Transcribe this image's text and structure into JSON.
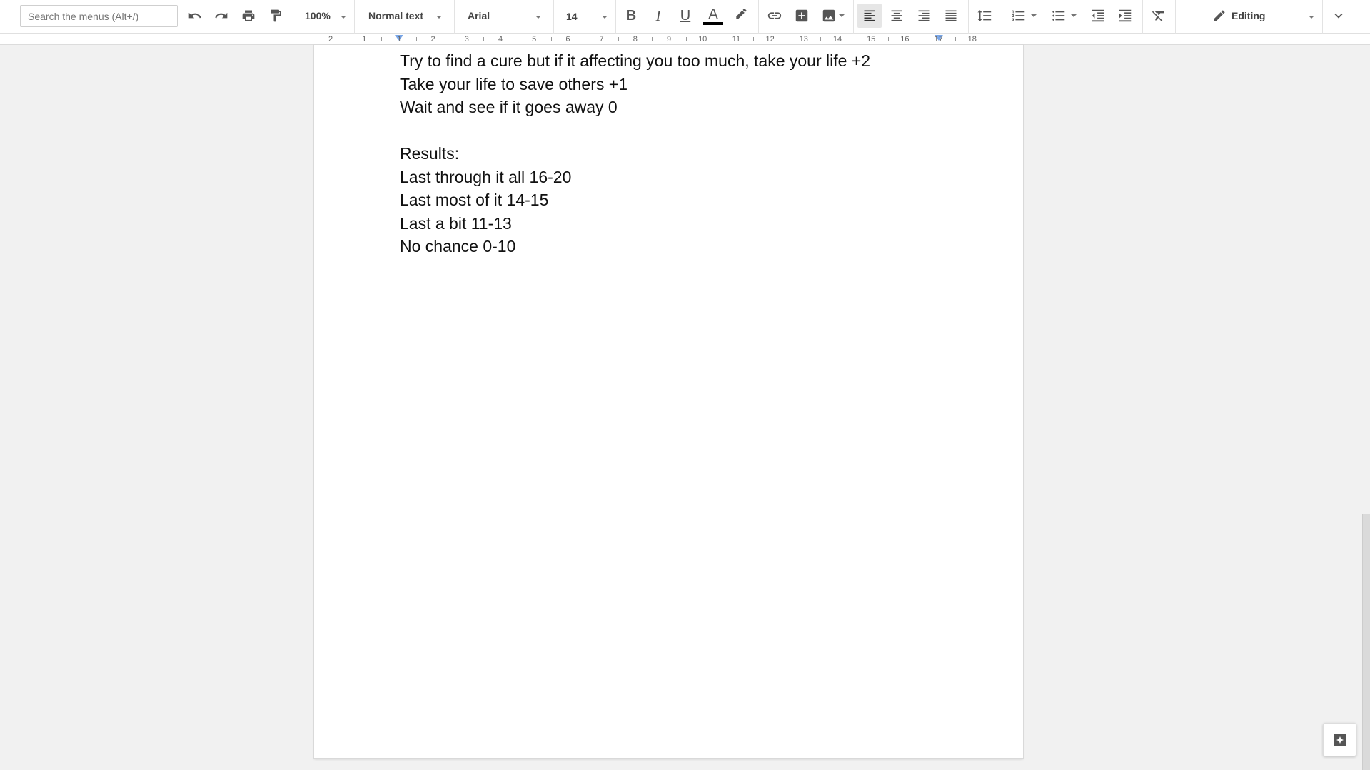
{
  "toolbar": {
    "search_placeholder": "Search the menus (Alt+/)",
    "zoom": "100%",
    "paragraph_style": "Normal text",
    "font": "Arial",
    "font_size": "14",
    "bold_label": "B",
    "italic_label": "I",
    "underline_label": "U",
    "text_color_label": "A",
    "mode": "Editing",
    "colors": {
      "text_color_bar": "#000000",
      "ruler_marker": "#7aa7e8"
    }
  },
  "ruler": {
    "numbers": [
      "2",
      "1",
      "1",
      "2",
      "3",
      "4",
      "5",
      "6",
      "7",
      "8",
      "9",
      "10",
      "11",
      "12",
      "13",
      "14",
      "15",
      "16",
      "17",
      "18"
    ]
  },
  "document": {
    "lines": [
      "Try to find a cure but if it affecting you too much, take your life +2",
      "Take your life to save others +1",
      "Wait and see if it goes away 0",
      "",
      "Results:",
      "Last through it all 16-20",
      "Last most of it 14-15",
      "Last a bit 11-13",
      "No chance 0-10"
    ]
  }
}
